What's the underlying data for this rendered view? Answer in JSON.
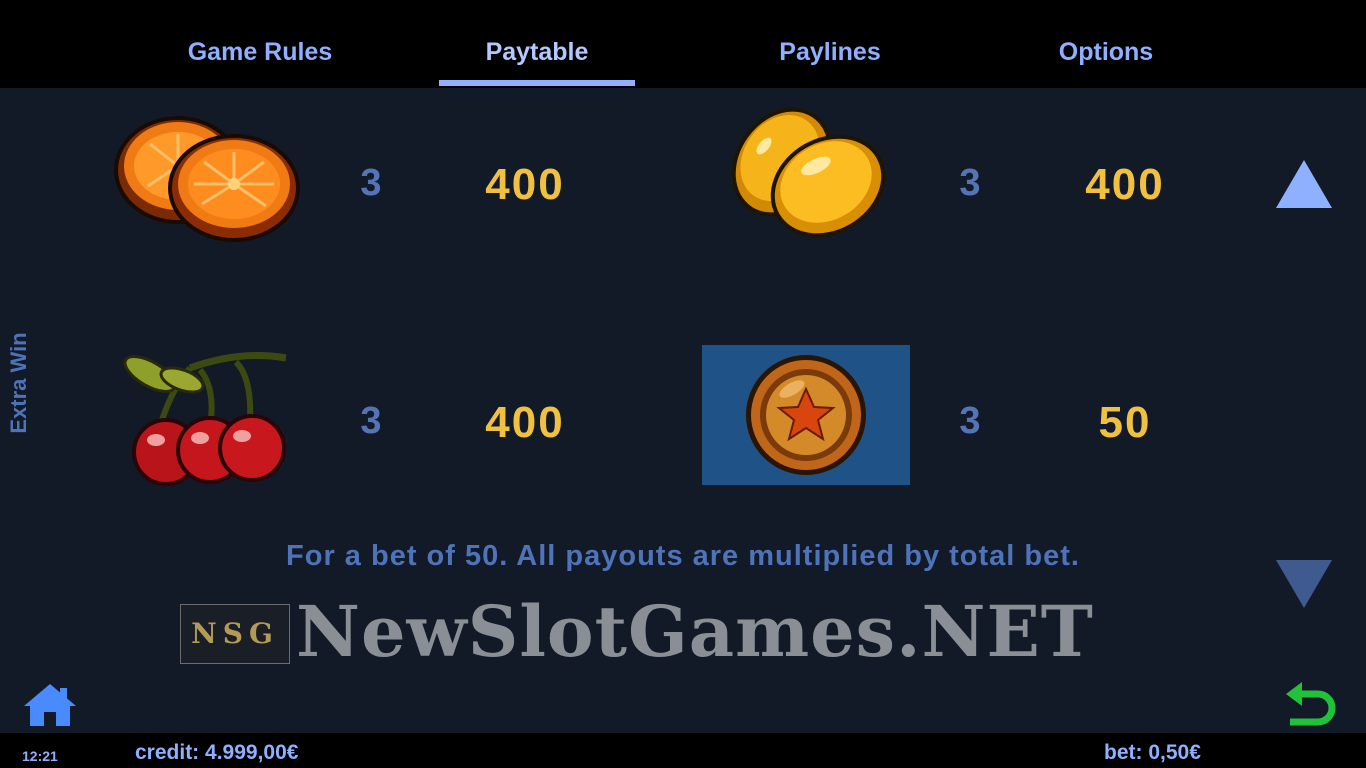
{
  "tabs": [
    {
      "label": "Game Rules",
      "active": false
    },
    {
      "label": "Paytable",
      "active": true
    },
    {
      "label": "Paylines",
      "active": false
    },
    {
      "label": "Options",
      "active": false
    }
  ],
  "side_label": "Extra Win",
  "rows": [
    {
      "symbol": "orange-icon",
      "count": "3",
      "payout": "400"
    },
    {
      "symbol": "lemon-icon",
      "count": "3",
      "payout": "400"
    },
    {
      "symbol": "cherry-icon",
      "count": "3",
      "payout": "400"
    },
    {
      "symbol": "star-coin-icon",
      "count": "3",
      "payout": "50"
    }
  ],
  "note": "For a bet of 50. All payouts are multiplied by total bet.",
  "watermark": {
    "logo": "NSG",
    "text": "NewSlotGames.NET"
  },
  "status": {
    "time": "12:21",
    "credit": "credit: 4.999,00€",
    "bet": "bet: 0,50€"
  },
  "colors": {
    "accent": "#8fb0ff",
    "payout": "#f0c040",
    "background": "#121a28",
    "back_arrow": "#22c13a"
  }
}
